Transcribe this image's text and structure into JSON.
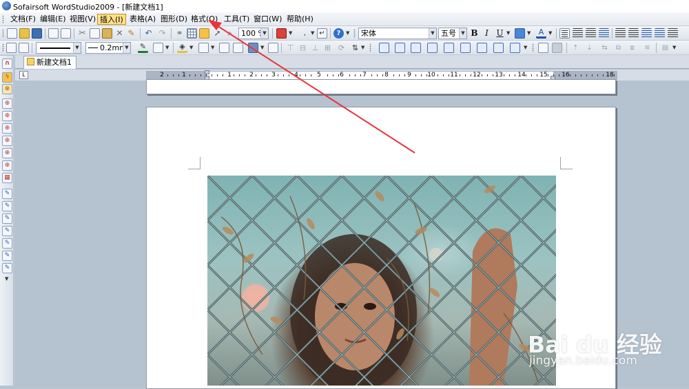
{
  "window": {
    "title": "Sofairsoft WordStudio2009 - [新建文档1]"
  },
  "menu": {
    "items": [
      {
        "label": "文档(F)"
      },
      {
        "label": "编辑(E)"
      },
      {
        "label": "视图(V)"
      },
      {
        "label": "插入(I)",
        "active": true
      },
      {
        "label": "表格(A)"
      },
      {
        "label": "图形(D)"
      },
      {
        "label": "格式(O)"
      },
      {
        "label": "工具(T)"
      },
      {
        "label": "窗口(W)"
      },
      {
        "label": "帮助(H)"
      }
    ]
  },
  "toolbar1": {
    "zoom_value": "100 %",
    "font_name": "宋体",
    "font_size": "五号",
    "bold_label": "B",
    "italic_label": "I",
    "underline_label": "U"
  },
  "toolbar2": {
    "line_width_value": "0.2mm"
  },
  "tabs": [
    {
      "label": "新建文档1"
    }
  ],
  "ruler": {
    "corner_label": "L",
    "numbers": [
      "2",
      "1",
      "1",
      "2",
      "3",
      "4",
      "5",
      "6",
      "7",
      "8",
      "9",
      "10",
      "11",
      "12",
      "13",
      "14",
      "15",
      "16",
      "18"
    ]
  },
  "watermark": {
    "brand": "Bai du 经验",
    "url": "jingyan.baidu.com"
  },
  "colors": {
    "accent_arrow": "#e8343a",
    "menu_active_bg": "#ffe08a",
    "workspace_bg": "#b5c2cf"
  },
  "icons": {
    "app": "wordstudio-app-icon",
    "watermark": "baidu-paw-icon"
  }
}
